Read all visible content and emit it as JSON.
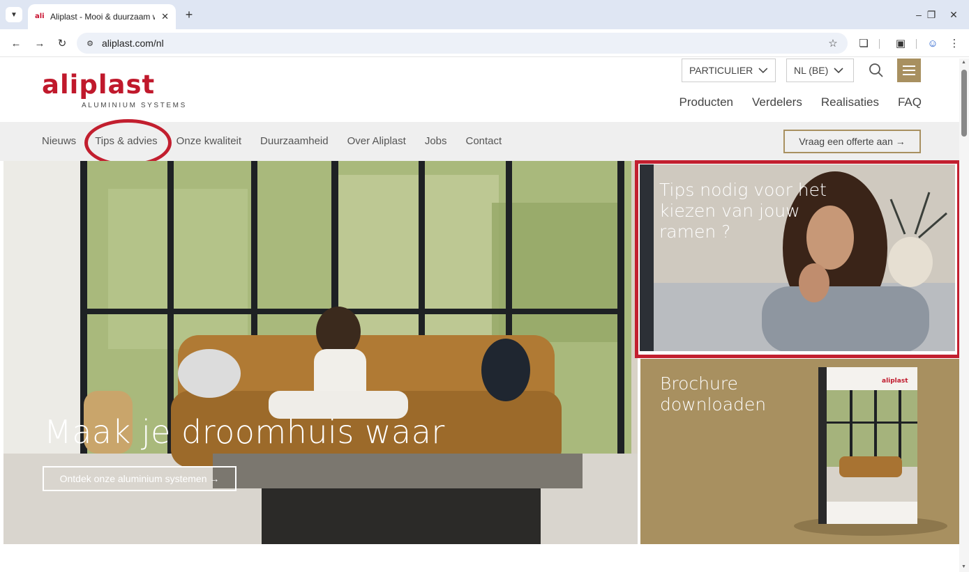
{
  "browser": {
    "tab_title": "Aliplast - Mooi & duurzaam wo",
    "tab_favicon": "ali",
    "url": "aliplast.com/nl",
    "icons": [
      "tab-list-icon",
      "close-icon",
      "plus-icon",
      "minimize-icon",
      "restore-icon",
      "close-window-icon",
      "back-icon",
      "forward-icon",
      "reload-icon",
      "site-info-icon",
      "star-icon",
      "extensions-icon",
      "screenshot-icon",
      "profile-icon",
      "kebab-menu-icon"
    ]
  },
  "header": {
    "logo_word": "aliplast",
    "logo_sub": "ALUMINIUM SYSTEMS",
    "audience_select": "PARTICULIER",
    "language_select": "NL (BE)",
    "main_nav": [
      "Producten",
      "Verdelers",
      "Realisaties",
      "FAQ"
    ]
  },
  "subnav": {
    "links": [
      "Nieuws",
      "Tips & advies",
      "Onze kwaliteit",
      "Duurzaamheid",
      "Over Aliplast",
      "Jobs",
      "Contact"
    ],
    "cta": "Vraag een offerte aan →"
  },
  "hero": {
    "title": "Maak je droomhuis waar",
    "button": "Ontdek onze aluminium systemen →"
  },
  "tiles": {
    "tips": "Tips nodig voor het kiezen van jouw ramen ?",
    "brochure": "Brochure downloaden",
    "brochure_cover_logo": "aliplast"
  },
  "colors": {
    "brand_red": "#c0192c",
    "accent_gold": "#a89060",
    "annotation_red": "#c21f2f"
  }
}
